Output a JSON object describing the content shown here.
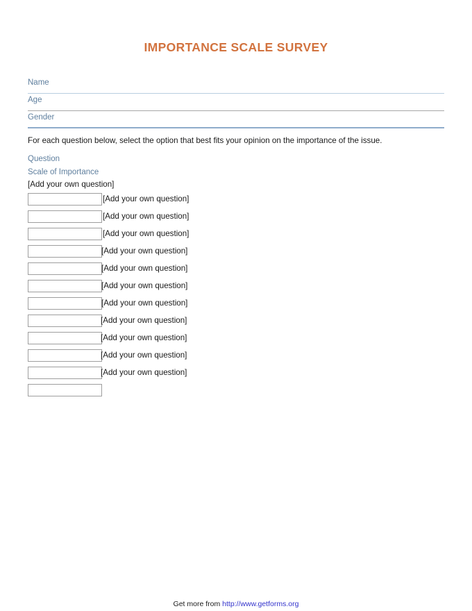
{
  "document": {
    "title": "IMPORTANCE SCALE SURVEY",
    "title_color": "#d2733f"
  },
  "identity_fields": [
    {
      "label": "Name",
      "value": "",
      "rule_style": "blue"
    },
    {
      "label": "Age",
      "value": "",
      "rule_style": "gray"
    },
    {
      "label": "Gender",
      "value": "",
      "rule_style": "blue-thick"
    }
  ],
  "instruction": "For each question below, select the option that best fits your opinion on the importance of the issue.",
  "column_headings": {
    "question": "Question",
    "scale": "Scale of Importance"
  },
  "first_question_label": "[Add your own question]",
  "question_rows": [
    {
      "input_value": "",
      "label": "[Add your own question]"
    },
    {
      "input_value": "",
      "label": "[Add your own question]"
    },
    {
      "input_value": "",
      "label": "[Add your own question]"
    },
    {
      "input_value": "",
      "label": "[Add your own question]"
    },
    {
      "input_value": "",
      "label": "[Add your own question]"
    },
    {
      "input_value": "",
      "label": "[Add your own question]"
    },
    {
      "input_value": "",
      "label": "[Add your own question]"
    },
    {
      "input_value": "",
      "label": "[Add your own question]"
    },
    {
      "input_value": "",
      "label": "[Add your own question]"
    },
    {
      "input_value": "",
      "label": "[Add your own question]"
    },
    {
      "input_value": "",
      "label": "[Add your own question]"
    },
    {
      "input_value": "",
      "label": ""
    }
  ],
  "footer": {
    "prefix": "Get more from ",
    "link_text": "http://www.getforms.org",
    "link_color": "#3333cc"
  },
  "colors": {
    "title_orange": "#d2733f",
    "label_blue": "#5f7f9e",
    "rule_blue": "#b8cfe0",
    "rule_gray": "#a6a6a6",
    "rule_blue_thick": "#8faccb",
    "box_border": "#9e9e9e",
    "body_text": "#1a1a1a",
    "page_background": "#ffffff"
  }
}
